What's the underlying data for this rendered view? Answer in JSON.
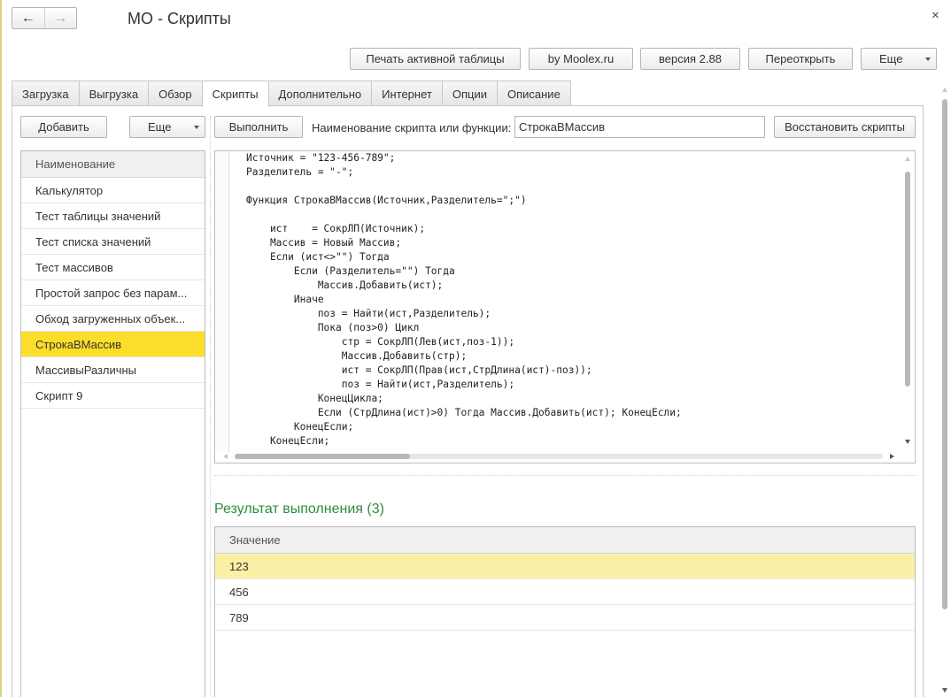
{
  "window": {
    "title": "МО - Скрипты",
    "back_icon": "←",
    "forward_icon": "→",
    "close_icon": "×"
  },
  "toolbar": {
    "print_label": "Печать активной таблицы",
    "moolex_label": "by Moolex.ru",
    "version_label": "версия 2.88",
    "reopen_label": "Переоткрыть",
    "more_label": "Еще"
  },
  "tabs": [
    {
      "label": "Загрузка"
    },
    {
      "label": "Выгрузка"
    },
    {
      "label": "Обзор"
    },
    {
      "label": "Скрипты"
    },
    {
      "label": "Дополнительно"
    },
    {
      "label": "Интернет"
    },
    {
      "label": "Опции"
    },
    {
      "label": "Описание"
    }
  ],
  "active_tab": "Скрипты",
  "scripts": {
    "add_label": "Добавить",
    "more_label": "Еще",
    "list_header": "Наименование",
    "items": [
      {
        "label": "Калькулятор"
      },
      {
        "label": "Тест таблицы значений"
      },
      {
        "label": "Тест списка значений"
      },
      {
        "label": "Тест массивов"
      },
      {
        "label": "Простой запрос без парам..."
      },
      {
        "label": "Обход загруженных объек..."
      },
      {
        "label": "СтрокаВМассив"
      },
      {
        "label": "МассивыРазличны"
      },
      {
        "label": "Скрипт 9"
      }
    ],
    "selected_item": "СтрокаВМассив"
  },
  "script_bar": {
    "run_label": "Выполнить",
    "name_label": "Наименование скрипта или функции:",
    "name_value": "СтрокаВМассив",
    "restore_label": "Восстановить скрипты"
  },
  "editor": {
    "code": "Источник = \"123-456-789\";\nРазделитель = \"-\";\n\nФункция СтрокаВМассив(Источник,Разделитель=\";\")\n\n    ист    = СокрЛП(Источник);\n    Массив = Новый Массив;\n    Если (ист<>\"\") Тогда\n        Если (Разделитель=\"\") Тогда\n            Массив.Добавить(ист);\n        Иначе\n            поз = Найти(ист,Разделитель);\n            Пока (поз>0) Цикл\n                стр = СокрЛП(Лев(ист,поз-1));\n                Массив.Добавить(стр);\n                ист = СокрЛП(Прав(ист,СтрДлина(ист)-поз));\n                поз = Найти(ист,Разделитель);\n            КонецЦикла;\n            Если (СтрДлина(ист)>0) Тогда Массив.Добавить(ист); КонецЕсли;\n        КонецЕсли;\n    КонецЕсли;"
  },
  "result": {
    "title": "Результат выполнения (3)",
    "column_header": "Значение",
    "rows": [
      {
        "value": "123"
      },
      {
        "value": "456"
      },
      {
        "value": "789"
      }
    ],
    "selected_row": "123"
  },
  "colors": {
    "selected_list": "#fbdd2a",
    "selected_row": "#fcefa6",
    "result_title": "#2e8b3c"
  }
}
